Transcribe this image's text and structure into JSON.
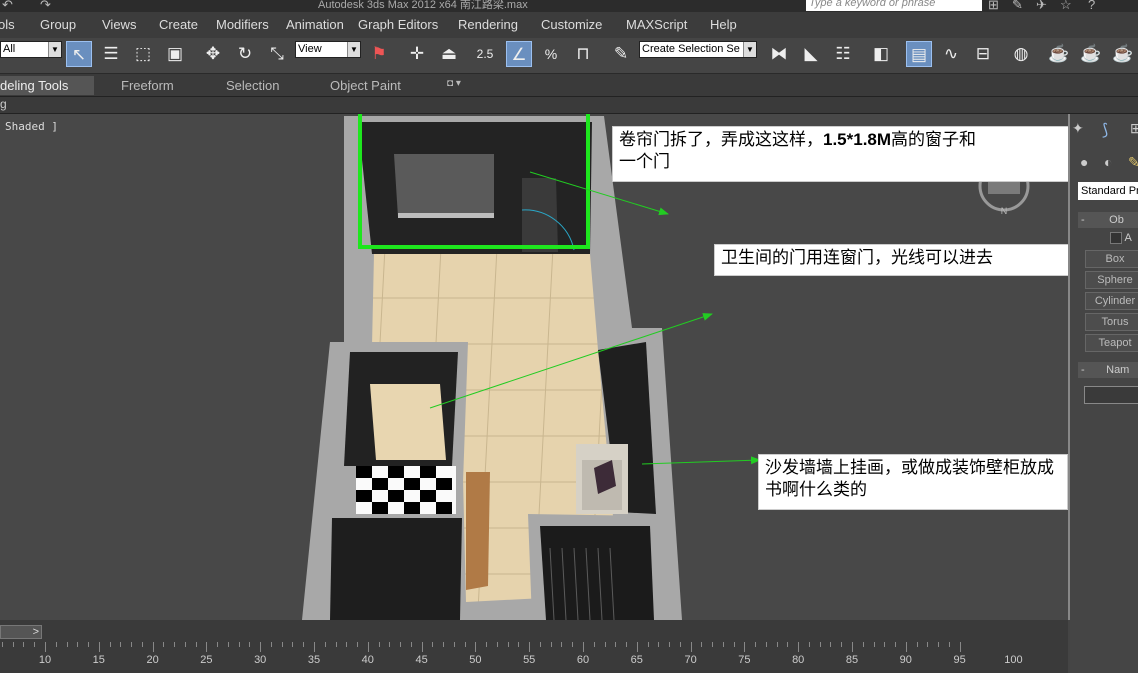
{
  "titlebar": {
    "title": "Autodesk 3ds Max  2012 x64      南江路梁.max",
    "search_placeholder": "Type a keyword or phrase"
  },
  "menu": [
    "ols",
    "Group",
    "Views",
    "Create",
    "Modifiers",
    "Animation",
    "Graph Editors",
    "Rendering",
    "Customize",
    "MAXScript",
    "Help"
  ],
  "toolbar": {
    "selection_filter": "All",
    "ref_coord": "View",
    "snap_value": "2.5",
    "named_selection": "Create Selection Se"
  },
  "ribbon": {
    "tabs": [
      "deling Tools",
      "Freeform",
      "Selection",
      "Object Paint"
    ]
  },
  "subbar": {
    "label": "g"
  },
  "viewport": {
    "label": "Shaded ]"
  },
  "right_panel": {
    "category": "Standard Pr",
    "rollout1": "Ob",
    "rollout2": "Nam",
    "autogrid_fragment": "A",
    "buttons": [
      "Box",
      "Sphere",
      "Cylinder",
      "Torus",
      "Teapot"
    ]
  },
  "notes": {
    "note1_line1_a": "卷帘门拆了，弄成这这样，",
    "note1_line1_b": "1.5*1.8M",
    "note1_line1_c": "高的窗子和",
    "note1_line2": "一个门",
    "note2": "卫生间的门用连窗门，光线可以进去",
    "note3_line1": "沙发墙墙上挂画，或做成装饰壁柜放成",
    "note3_line2": "书啊什么类的"
  },
  "timeline": {
    "slider_label": ">",
    "ticks": [
      "10",
      "15",
      "20",
      "25",
      "30",
      "35",
      "40",
      "45",
      "50",
      "55",
      "60",
      "65",
      "70",
      "75",
      "80",
      "85",
      "90",
      "95",
      "100"
    ]
  },
  "colors": {
    "highlight_box": "#1ee61e",
    "arrow": "#22cc22",
    "floor": "#e6d3ad",
    "wall": "#a8a8a8"
  }
}
